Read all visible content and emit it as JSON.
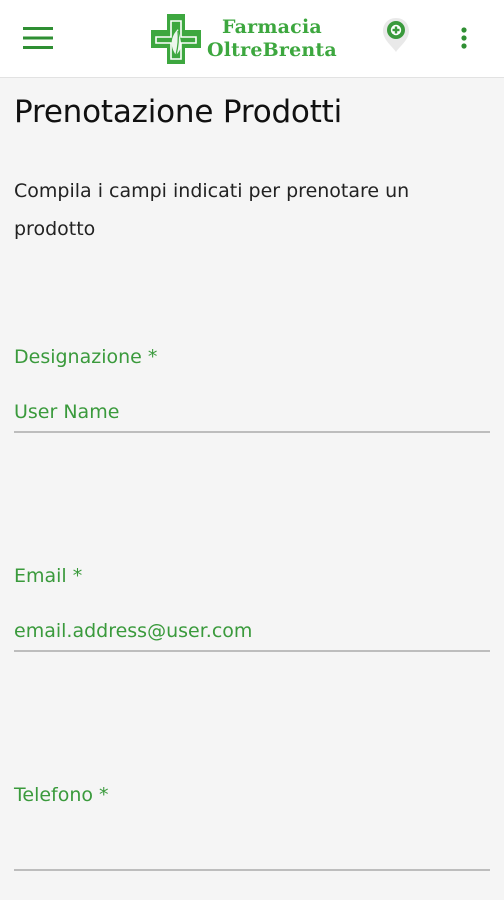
{
  "header": {
    "menu_icon": "hamburger-menu-icon",
    "logo_line1": "Farmacia",
    "logo_line2": "OltreBrenta",
    "logo_mark_icon": "pharmacy-cross-icon",
    "location_icon": "map-pin-plus-icon",
    "overflow_icon": "more-vertical-icon"
  },
  "page": {
    "title": "Prenotazione Prodotti",
    "intro": "Compila i campi indicati per prenotare un prodotto"
  },
  "form": {
    "designazione": {
      "label": "Designazione *",
      "placeholder": "User Name"
    },
    "email": {
      "label": "Email *",
      "placeholder": "email.address@user.com"
    },
    "telefono": {
      "label": "Telefono *",
      "placeholder": ""
    }
  },
  "colors": {
    "brand_green": "#3da73f",
    "label_green": "#3a9a3c",
    "background": "#f5f5f5",
    "appbar": "#ffffff"
  }
}
